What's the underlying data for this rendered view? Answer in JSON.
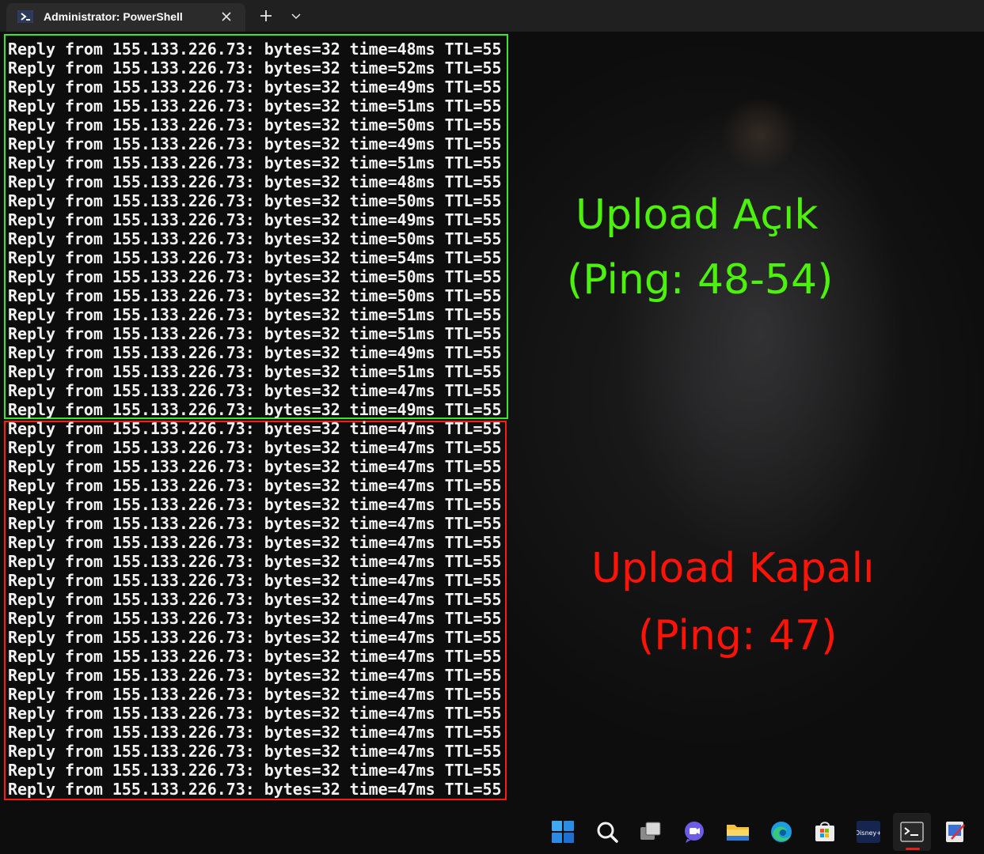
{
  "window": {
    "tab_title": "Administrator: PowerShell"
  },
  "icons": {
    "tab": "powershell-icon",
    "close": "close-icon",
    "new_tab": "plus-icon",
    "dropdown": "chevron-down-icon"
  },
  "terminal": {
    "lines_green": [
      "Reply from 155.133.226.73: bytes=32 time=48ms TTL=55",
      "Reply from 155.133.226.73: bytes=32 time=52ms TTL=55",
      "Reply from 155.133.226.73: bytes=32 time=49ms TTL=55",
      "Reply from 155.133.226.73: bytes=32 time=51ms TTL=55",
      "Reply from 155.133.226.73: bytes=32 time=50ms TTL=55",
      "Reply from 155.133.226.73: bytes=32 time=49ms TTL=55",
      "Reply from 155.133.226.73: bytes=32 time=51ms TTL=55",
      "Reply from 155.133.226.73: bytes=32 time=48ms TTL=55",
      "Reply from 155.133.226.73: bytes=32 time=50ms TTL=55",
      "Reply from 155.133.226.73: bytes=32 time=49ms TTL=55",
      "Reply from 155.133.226.73: bytes=32 time=50ms TTL=55",
      "Reply from 155.133.226.73: bytes=32 time=54ms TTL=55",
      "Reply from 155.133.226.73: bytes=32 time=50ms TTL=55",
      "Reply from 155.133.226.73: bytes=32 time=50ms TTL=55",
      "Reply from 155.133.226.73: bytes=32 time=51ms TTL=55",
      "Reply from 155.133.226.73: bytes=32 time=51ms TTL=55",
      "Reply from 155.133.226.73: bytes=32 time=49ms TTL=55",
      "Reply from 155.133.226.73: bytes=32 time=51ms TTL=55",
      "Reply from 155.133.226.73: bytes=32 time=47ms TTL=55",
      "Reply from 155.133.226.73: bytes=32 time=49ms TTL=55"
    ],
    "lines_red": [
      "Reply from 155.133.226.73: bytes=32 time=47ms TTL=55",
      "Reply from 155.133.226.73: bytes=32 time=47ms TTL=55",
      "Reply from 155.133.226.73: bytes=32 time=47ms TTL=55",
      "Reply from 155.133.226.73: bytes=32 time=47ms TTL=55",
      "Reply from 155.133.226.73: bytes=32 time=47ms TTL=55",
      "Reply from 155.133.226.73: bytes=32 time=47ms TTL=55",
      "Reply from 155.133.226.73: bytes=32 time=47ms TTL=55",
      "Reply from 155.133.226.73: bytes=32 time=47ms TTL=55",
      "Reply from 155.133.226.73: bytes=32 time=47ms TTL=55",
      "Reply from 155.133.226.73: bytes=32 time=47ms TTL=55",
      "Reply from 155.133.226.73: bytes=32 time=47ms TTL=55",
      "Reply from 155.133.226.73: bytes=32 time=47ms TTL=55",
      "Reply from 155.133.226.73: bytes=32 time=47ms TTL=55",
      "Reply from 155.133.226.73: bytes=32 time=47ms TTL=55",
      "Reply from 155.133.226.73: bytes=32 time=47ms TTL=55",
      "Reply from 155.133.226.73: bytes=32 time=47ms TTL=55",
      "Reply from 155.133.226.73: bytes=32 time=47ms TTL=55",
      "Reply from 155.133.226.73: bytes=32 time=47ms TTL=55",
      "Reply from 155.133.226.73: bytes=32 time=47ms TTL=55",
      "Reply from 155.133.226.73: bytes=32 time=47ms TTL=55"
    ]
  },
  "annotations": {
    "green_title": "Upload Açık",
    "green_sub": "(Ping: 48-54)",
    "red_title": "Upload Kapalı",
    "red_sub": "(Ping: 47)",
    "green_color": "#4cf20c",
    "red_color": "#ff1306"
  },
  "taskbar": {
    "items": [
      "start-icon",
      "search-icon",
      "task-view-icon",
      "chat-icon",
      "file-explorer-icon",
      "edge-icon",
      "store-icon",
      "disney-plus-icon",
      "terminal-icon",
      "snipping-tool-icon"
    ],
    "disney_text": "Disney+"
  }
}
